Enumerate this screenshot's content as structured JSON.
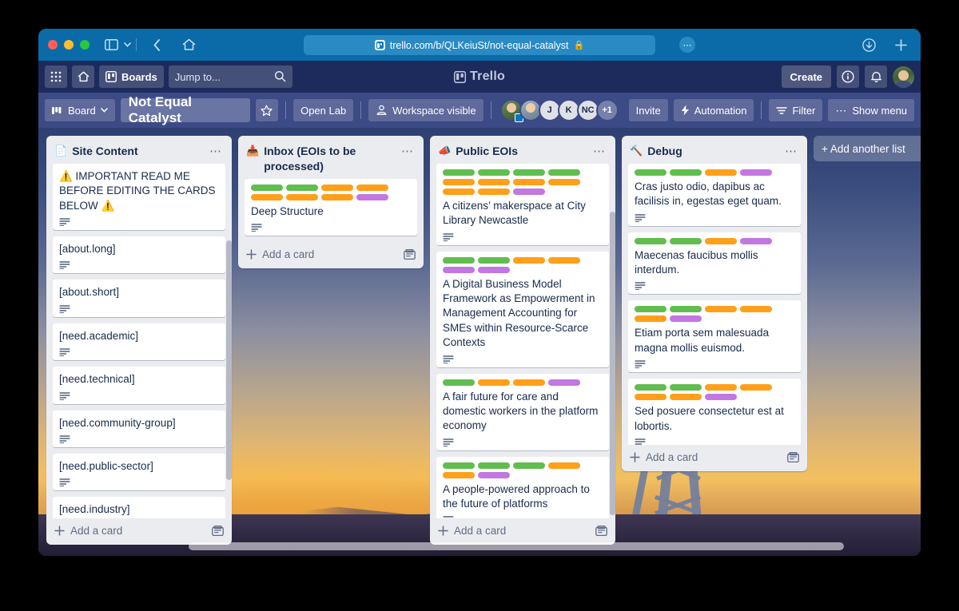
{
  "browser": {
    "url": "trello.com/b/QLKeiuSt/not-equal-catalyst",
    "lock_icon": "lock-icon",
    "sidebar_icon": "sidebar-toggle-icon",
    "back_icon": "back-chevron-icon",
    "home_icon": "home-icon",
    "download_icon": "download-icon",
    "newtab_icon": "new-tab-icon",
    "more_icon": "page-menu-icon",
    "dropdown_icon": "chevron-down-icon"
  },
  "topnav": {
    "apps_label": "apps-grid-icon",
    "home_label": "home-icon",
    "boards_label": "Boards",
    "boards_icon": "board-icon",
    "jump_placeholder": "Jump to...",
    "search_icon": "search-icon",
    "brand": "Trello",
    "brand_icon": "trello-logo-icon",
    "create_label": "Create",
    "info_icon": "info-icon",
    "bell_icon": "notifications-bell-icon",
    "avatar": "user-avatar"
  },
  "board_header": {
    "board_button": "Board",
    "board_button_icon": "board-view-icon",
    "title": "Not Equal Catalyst",
    "star_icon": "star-icon",
    "workspace": "Open Lab",
    "visibility": "Workspace visible",
    "visibility_icon": "workspace-visible-icon",
    "members": [
      "J",
      "K",
      "NC",
      "+1"
    ],
    "invite_label": "Invite",
    "automation_label": "Automation",
    "automation_icon": "bolt-icon",
    "filter_label": "Filter",
    "filter_icon": "filter-icon",
    "menu_label": "Show menu",
    "menu_icon": "ellipsis-icon"
  },
  "colors": {
    "green": "#61bd4f",
    "orange": "#ff9f1a",
    "purple": "#c377e0",
    "list_bg": "#ebecf0",
    "board_header_bg": "#3c4a86",
    "nav_bg": "#1d2a5c"
  },
  "add_another_list": "+ Add another list",
  "add_card_label": "Add a card",
  "card_template_icon": "card-template-icon",
  "lists": [
    {
      "name": "Site Content",
      "emoji": "📄",
      "emoji_name": "page-icon",
      "menu_icon": "list-actions-icon",
      "cards": [
        {
          "title": "⚠️ IMPORTANT READ ME BEFORE EDITING THE CARDS BELOW ⚠️",
          "labels": [],
          "has_description": true
        },
        {
          "title": "[about.long]",
          "labels": [],
          "has_description": true
        },
        {
          "title": "[about.short]",
          "labels": [],
          "has_description": true
        },
        {
          "title": "[need.academic]",
          "labels": [],
          "has_description": true
        },
        {
          "title": "[need.technical]",
          "labels": [],
          "has_description": true
        },
        {
          "title": "[need.community-group]",
          "labels": [],
          "has_description": true
        },
        {
          "title": "[need.public-sector]",
          "labels": [],
          "has_description": true
        },
        {
          "title": "[need.industry]",
          "labels": [],
          "has_description": false
        }
      ]
    },
    {
      "name": "Inbox (EOIs to be processed)",
      "emoji": "📥",
      "emoji_name": "inbox-tray-icon",
      "menu_icon": "list-actions-icon",
      "cards": [
        {
          "title": "Deep Structure",
          "labels": [
            "green",
            "green",
            "orange",
            "orange",
            "orange",
            "orange",
            "orange",
            "purple"
          ],
          "has_description": true
        }
      ]
    },
    {
      "name": "Public EOIs",
      "emoji": "📣",
      "emoji_name": "megaphone-icon",
      "menu_icon": "list-actions-icon",
      "cards": [
        {
          "title": "A citizens’ makerspace at City Library Newcastle",
          "labels": [
            "green",
            "green",
            "green",
            "green",
            "orange",
            "orange",
            "orange",
            "orange",
            "orange",
            "orange",
            "purple"
          ],
          "has_description": true
        },
        {
          "title": "A Digital Business Model Framework as Empowerment in Management Accounting for SMEs within Resource-Scarce Contexts",
          "labels": [
            "green",
            "green",
            "orange",
            "orange",
            "purple",
            "purple"
          ],
          "has_description": true
        },
        {
          "title": "A fair future for care and domestic workers in the platform economy",
          "labels": [
            "green",
            "orange",
            "orange",
            "purple"
          ],
          "has_description": true
        },
        {
          "title": "A people-powered approach to the future of platforms",
          "labels": [
            "green",
            "green",
            "green",
            "orange",
            "orange",
            "purple"
          ],
          "has_description": true
        },
        {
          "title": "",
          "labels": [
            "green",
            "green",
            "green",
            "green",
            "orange",
            "orange",
            "orange",
            "orange",
            "orange",
            "purple"
          ],
          "has_description": false
        }
      ]
    },
    {
      "name": "Debug",
      "emoji": "🔨",
      "emoji_name": "hammer-icon",
      "menu_icon": "list-actions-icon",
      "cards": [
        {
          "title": "Cras justo odio, dapibus ac facilisis in, egestas eget quam.",
          "labels": [
            "green",
            "green",
            "orange",
            "purple"
          ],
          "has_description": true
        },
        {
          "title": "Maecenas faucibus mollis interdum.",
          "labels": [
            "green",
            "green",
            "orange",
            "purple"
          ],
          "has_description": true
        },
        {
          "title": "Etiam porta sem malesuada magna mollis euismod.",
          "labels": [
            "green",
            "green",
            "orange",
            "orange",
            "orange",
            "purple"
          ],
          "has_description": true
        },
        {
          "title": "Sed posuere consectetur est at lobortis.",
          "labels": [
            "green",
            "green",
            "orange",
            "orange",
            "orange",
            "orange",
            "purple"
          ],
          "has_description": true
        }
      ]
    }
  ]
}
